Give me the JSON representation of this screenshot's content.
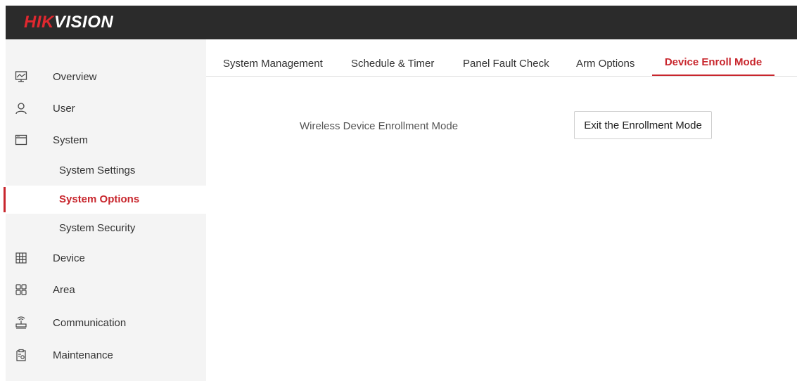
{
  "brand": {
    "logo_part1": "HIK",
    "logo_part2": "VISION",
    "accent_color": "#c8262d"
  },
  "sidebar": {
    "items": [
      {
        "label": "Overview",
        "icon": "monitor-icon"
      },
      {
        "label": "User",
        "icon": "user-icon"
      },
      {
        "label": "System",
        "icon": "window-icon"
      },
      {
        "label": "Device",
        "icon": "device-grid-icon"
      },
      {
        "label": "Area",
        "icon": "area-grid-icon"
      },
      {
        "label": "Communication",
        "icon": "router-icon"
      },
      {
        "label": "Maintenance",
        "icon": "clipboard-gear-icon"
      }
    ],
    "system_subitems": [
      {
        "label": "System Settings",
        "active": false
      },
      {
        "label": "System Options",
        "active": true
      },
      {
        "label": "System Security",
        "active": false
      }
    ]
  },
  "tabs": [
    {
      "label": "System Management",
      "active": false
    },
    {
      "label": "Schedule & Timer",
      "active": false
    },
    {
      "label": "Panel Fault Check",
      "active": false
    },
    {
      "label": "Arm Options",
      "active": false
    },
    {
      "label": "Device Enroll Mode",
      "active": true
    }
  ],
  "content": {
    "field_label": "Wireless Device Enrollment Mode",
    "button_label": "Exit the Enrollment Mode"
  }
}
